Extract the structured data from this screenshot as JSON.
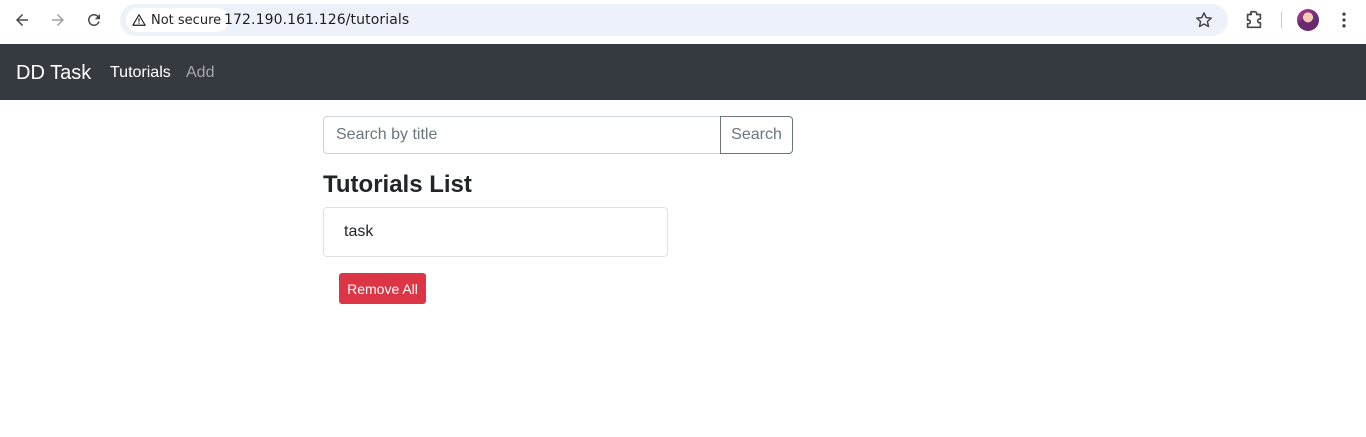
{
  "browser": {
    "security_label": "Not secure",
    "url": "172.190.161.126/tutorials"
  },
  "navbar": {
    "brand": "DD Task",
    "links": [
      {
        "label": "Tutorials"
      },
      {
        "label": "Add"
      }
    ]
  },
  "search": {
    "placeholder": "Search by title",
    "value": "",
    "button_label": "Search"
  },
  "list": {
    "title": "Tutorials List",
    "items": [
      {
        "title": "task"
      }
    ]
  },
  "actions": {
    "remove_all_label": "Remove All"
  },
  "colors": {
    "navbar_bg": "#343a40",
    "danger": "#dc3545",
    "secondary": "#6c757d",
    "address_bar_bg": "#edf2fa"
  },
  "icons": [
    "back-icon",
    "forward-icon",
    "reload-icon",
    "warning-icon",
    "bookmark-star-icon",
    "extensions-icon",
    "profile-avatar",
    "more-menu-icon"
  ]
}
